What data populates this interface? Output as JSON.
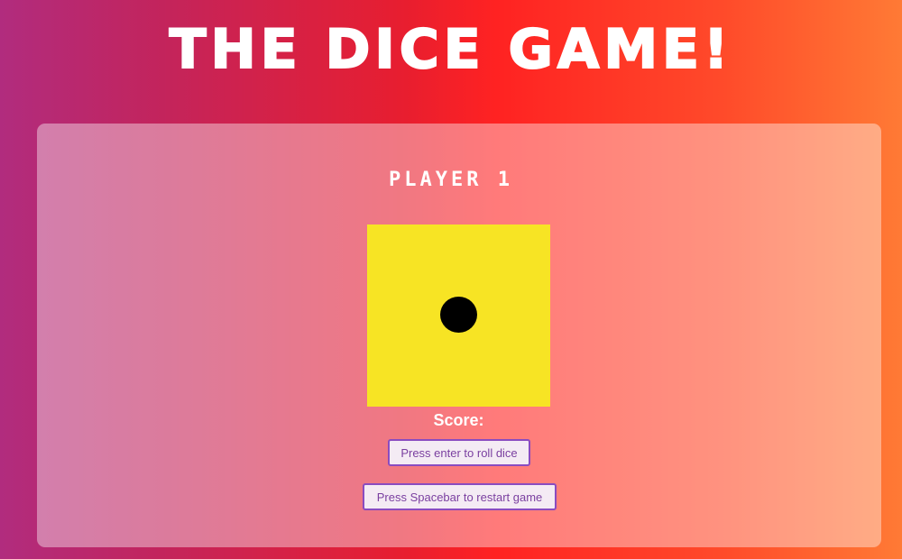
{
  "header": {
    "title": "The Dice Game!"
  },
  "game": {
    "player_label": "Player 1",
    "die_face_value": 1,
    "die_color": "#f7e424",
    "score_label": "Score:",
    "roll_button_label": "Press enter to roll dice",
    "restart_button_label": "Press Spacebar to restart game"
  },
  "colors": {
    "accent": "#8a4cc0",
    "gradient_start": "#b12c7e",
    "gradient_mid": "#ff2222",
    "gradient_end": "#ff7a35"
  }
}
